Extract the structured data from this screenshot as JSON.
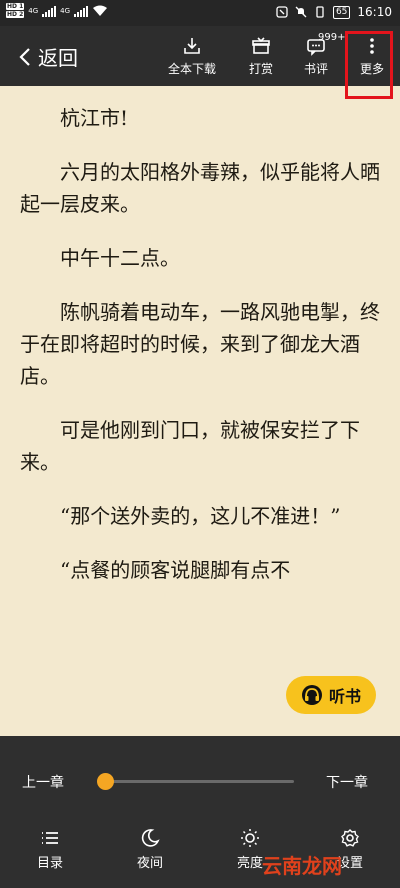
{
  "status_bar": {
    "hd1": "HD 1",
    "hd2": "HD 2",
    "net1": "4G",
    "net2": "4G",
    "battery": "65",
    "time": "16:10"
  },
  "top_bar": {
    "back_label": "返回",
    "download_label": "全本下载",
    "tip_label": "打赏",
    "review_label": "书评",
    "review_badge": "999+",
    "more_label": "更多"
  },
  "content": {
    "paragraphs": [
      "杭江市!",
      "六月的太阳格外毒辣，似乎能将人晒起一层皮来。",
      "中午十二点。",
      "陈帆骑着电动车，一路风驰电掣，终于在即将超时的时候，来到了御龙大酒店。",
      "可是他刚到门口，就被保安拦了下来。",
      "“那个送外卖的，这儿不准进！”",
      "“点餐的顾客说腿脚有点不"
    ]
  },
  "listen_button": {
    "label": "听书"
  },
  "bottom_panel": {
    "prev_chapter": "上一章",
    "next_chapter": "下一章",
    "progress": 0,
    "items": [
      {
        "label": "目录",
        "icon": "list-icon"
      },
      {
        "label": "夜间",
        "icon": "moon-icon"
      },
      {
        "label": "亮度",
        "icon": "sun-icon"
      },
      {
        "label": "设置",
        "icon": "gear-icon"
      }
    ]
  },
  "watermark": "云南龙网",
  "colors": {
    "page_bg": "#f3e9cf",
    "bar_bg": "#2d2d2d",
    "accent": "#f5a623",
    "listen_bg": "#f7c21d",
    "highlight": "#e3141c"
  }
}
